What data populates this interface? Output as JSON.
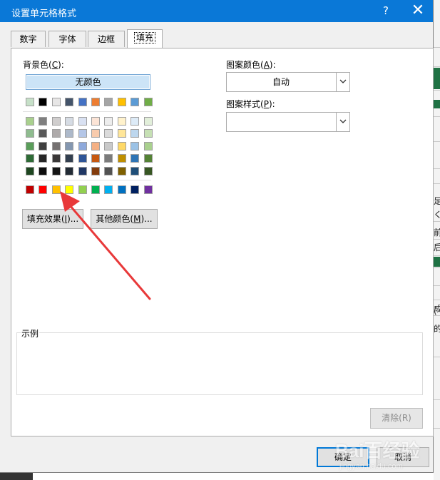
{
  "dialog": {
    "title": "设置单元格格式",
    "help_label": "?",
    "close_label": "✕"
  },
  "tabs": [
    {
      "label": "数字",
      "active": false
    },
    {
      "label": "字体",
      "active": false
    },
    {
      "label": "边框",
      "active": false
    },
    {
      "label": "填充",
      "active": true
    }
  ],
  "fill": {
    "bg_color_label": "背景色",
    "bg_color_key": "C",
    "no_color_label": "无颜色",
    "theme_colors_row": [
      "#c6e0c8",
      "#000000",
      "#e7e6e6",
      "#44546a",
      "#4472c4",
      "#ed7d31",
      "#a5a5a5",
      "#ffc000",
      "#5b9bd5",
      "#70ad47"
    ],
    "tint_rows": [
      [
        "#a9d08e",
        "#7f7f7f",
        "#d0cece",
        "#d6dce4",
        "#d9e1f2",
        "#fce4d6",
        "#ededed",
        "#fff2cc",
        "#ddebf7",
        "#e2efda"
      ],
      [
        "#8fbc8f",
        "#595959",
        "#aeaaaa",
        "#adb9ca",
        "#b4c6e7",
        "#f8cbad",
        "#dbdbdb",
        "#ffe699",
        "#bdd7ee",
        "#c6e0b4"
      ],
      [
        "#5a9e5a",
        "#3f3f3f",
        "#757171",
        "#8497b0",
        "#8ea9db",
        "#f4b084",
        "#c9c9c9",
        "#ffd966",
        "#9bc2e6",
        "#a9d08e"
      ],
      [
        "#2e6b36",
        "#262626",
        "#3a3838",
        "#333f4f",
        "#2f5597",
        "#c65911",
        "#7b7b7b",
        "#bf8f00",
        "#2f75b5",
        "#548235"
      ],
      [
        "#1e4620",
        "#0d0d0d",
        "#161616",
        "#222b35",
        "#203764",
        "#833c0c",
        "#525252",
        "#7f6000",
        "#1f4e78",
        "#375623"
      ]
    ],
    "standard_colors": [
      "#c00000",
      "#ff0000",
      "#ffc000",
      "#ffff00",
      "#92d050",
      "#00b050",
      "#00b0f0",
      "#0070c0",
      "#002060",
      "#7030a0"
    ],
    "fill_effects_label": "填充效果",
    "fill_effects_key": "I",
    "more_colors_label": "其他颜色",
    "more_colors_key": "M",
    "pattern_color_label": "图案颜色",
    "pattern_color_key": "A",
    "pattern_color_value": "自动",
    "pattern_style_label": "图案样式",
    "pattern_style_key": "P",
    "pattern_style_value": "",
    "sample_label": "示例",
    "clear_label": "清除(R)"
  },
  "footer": {
    "ok_label": "确定",
    "cancel_label": "取消"
  },
  "background_glyphs": [
    "足",
    "く",
    "前",
    "后",
    "成",
    "的",
    "("
  ],
  "watermark": {
    "main": "Bai百经验",
    "url": "jingyan.baidu.com"
  },
  "colors": {
    "titlebar": "#0a78d7",
    "annotation_arrow": "#e8393a",
    "selected_button_bg": "#cce4f7"
  }
}
